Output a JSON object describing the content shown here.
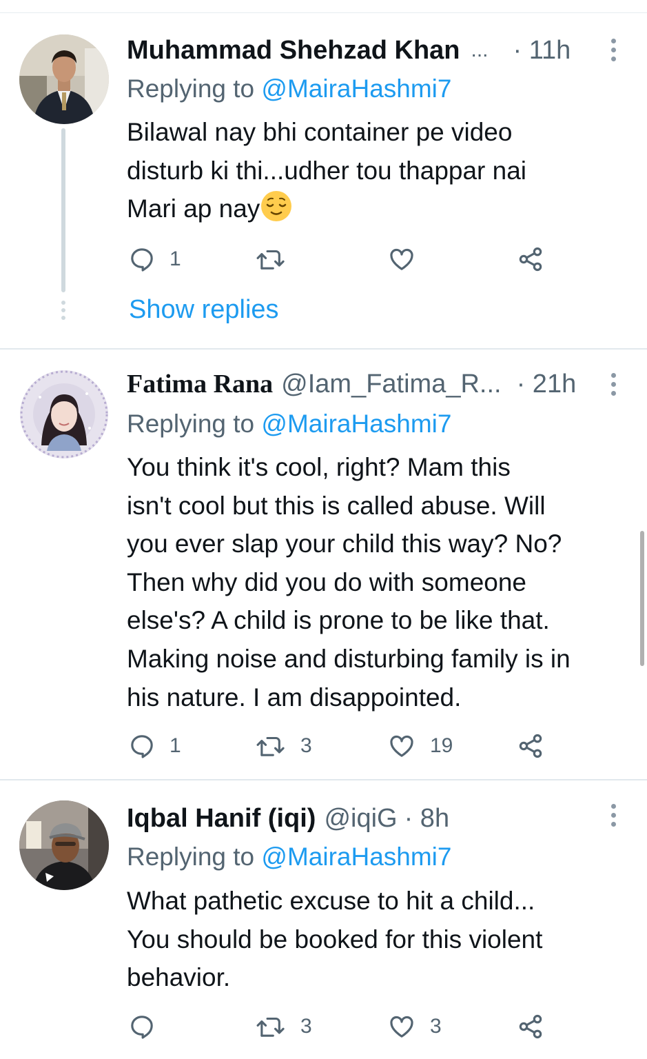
{
  "tweets": [
    {
      "name": "Muhammad Shehzad Khan",
      "ellipsis": "...",
      "handle": "",
      "time": "· 11h",
      "reply_prefix": "Replying to ",
      "reply_to": "@MairaHashmi7",
      "text_lines": [
        "Bilawal nay bhi container pe video",
        "disturb ki thi...udher tou thappar nai",
        "Mari ap nay"
      ],
      "emoji": "relieved-face-emoji",
      "replies": "1",
      "retweets": "",
      "likes": "",
      "show_replies": "Show replies"
    },
    {
      "name": "Fatima Rana",
      "handle": "@Iam_Fatima_R...",
      "time": "· 21h",
      "reply_prefix": "Replying to ",
      "reply_to": "@MairaHashmi7",
      "text_lines": [
        "You think it's cool, right? Mam this",
        "isn't cool but this is called abuse. Will",
        "you ever slap your child this way? No?",
        "Then why did you do with someone",
        "else's? A child is prone to be like that.",
        "Making noise and disturbing family is in",
        "his nature. I am disappointed."
      ],
      "replies": "1",
      "retweets": "3",
      "likes": "19"
    },
    {
      "name": "Iqbal Hanif (iqi)",
      "handle": "@iqiG",
      "time": "· 8h",
      "reply_prefix": "Replying to ",
      "reply_to": "@MairaHashmi7",
      "text_lines": [
        "What pathetic excuse to hit a child...",
        "You should be booked for this violent",
        "behavior."
      ],
      "replies": "",
      "retweets": "3",
      "likes": "3"
    }
  ],
  "icons": {
    "reply": "reply-icon",
    "retweet": "retweet-icon",
    "like": "like-icon",
    "share": "share-icon",
    "more": "more-options-icon"
  },
  "colors": {
    "link": "#1d9bf0",
    "secondary_text": "#536471",
    "primary_text": "#0f1419",
    "divider": "#e1e8ed"
  }
}
